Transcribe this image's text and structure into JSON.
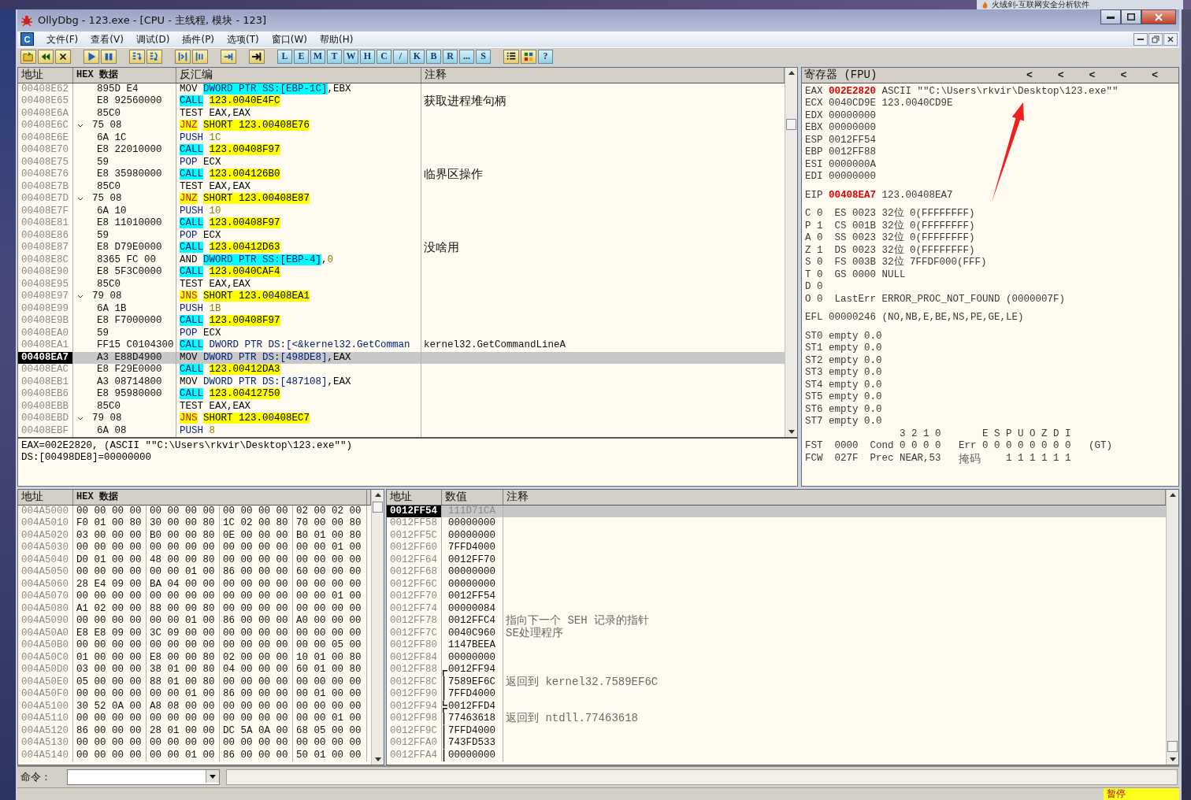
{
  "background_window": {
    "title": "火绒剑-互联网安全分析软件"
  },
  "window": {
    "title": "OllyDbg - 123.exe - [CPU - 主线程, 模块 - 123]"
  },
  "menu": {
    "icon_letter": "C",
    "items": [
      "文件(F)",
      "查看(V)",
      "调试(D)",
      "插件(P)",
      "选项(T)",
      "窗口(W)",
      "帮助(H)"
    ]
  },
  "toolbar": {
    "letter_buttons": [
      "L",
      "E",
      "M",
      "T",
      "W",
      "H",
      "C",
      "/",
      "K",
      "B",
      "R",
      "...",
      "S"
    ],
    "help_button": "?"
  },
  "disasm": {
    "headers": [
      "地址",
      "HEX 数据",
      "反汇编",
      "注释"
    ],
    "rows": [
      {
        "address": "00408E62",
        "hex": "895D E4",
        "jump": false,
        "selected": false,
        "parts": [
          {
            "kind": "plain",
            "text": "MOV"
          },
          {
            "kind": "memss",
            "text": "DWORD PTR SS:[EBP-1C]"
          },
          {
            "kind": "comma",
            "text": ",EBX"
          }
        ]
      },
      {
        "address": "00408E65",
        "hex": "E8 92560000",
        "jump": false,
        "selected": false,
        "parts": [
          {
            "kind": "call",
            "text": "CALL"
          },
          {
            "kind": "target",
            "text": "123.0040E4FC"
          }
        ],
        "comment": {
          "kind": "note",
          "text": "获取进程堆句柄"
        }
      },
      {
        "address": "00408E6A",
        "hex": "85C0",
        "jump": false,
        "selected": false,
        "parts": [
          {
            "kind": "plain",
            "text": "TEST"
          },
          {
            "kind": "plain",
            "text": "EAX,EAX"
          }
        ]
      },
      {
        "address": "00408E6C",
        "hex": "75 08",
        "jump": true,
        "selected": false,
        "parts": [
          {
            "kind": "jcc",
            "text": "JNZ"
          },
          {
            "kind": "target",
            "text": "SHORT 123.00408E76"
          }
        ]
      },
      {
        "address": "00408E6E",
        "hex": "6A 1C",
        "jump": false,
        "selected": false,
        "parts": [
          {
            "kind": "stack",
            "text": "PUSH"
          },
          {
            "kind": "const",
            "text": "1C"
          }
        ]
      },
      {
        "address": "00408E70",
        "hex": "E8 22010000",
        "jump": false,
        "selected": false,
        "parts": [
          {
            "kind": "call",
            "text": "CALL"
          },
          {
            "kind": "target",
            "text": "123.00408F97"
          }
        ]
      },
      {
        "address": "00408E75",
        "hex": "59",
        "jump": false,
        "selected": false,
        "parts": [
          {
            "kind": "stack",
            "text": "POP"
          },
          {
            "kind": "plain",
            "text": "ECX"
          }
        ]
      },
      {
        "address": "00408E76",
        "hex": "E8 35980000",
        "jump": false,
        "selected": false,
        "parts": [
          {
            "kind": "call",
            "text": "CALL"
          },
          {
            "kind": "target",
            "text": "123.004126B0"
          }
        ],
        "comment": {
          "kind": "note",
          "text": "临界区操作"
        }
      },
      {
        "address": "00408E7B",
        "hex": "85C0",
        "jump": false,
        "selected": false,
        "parts": [
          {
            "kind": "plain",
            "text": "TEST"
          },
          {
            "kind": "plain",
            "text": "EAX,EAX"
          }
        ]
      },
      {
        "address": "00408E7D",
        "hex": "75 08",
        "jump": true,
        "selected": false,
        "parts": [
          {
            "kind": "jcc",
            "text": "JNZ"
          },
          {
            "kind": "target",
            "text": "SHORT 123.00408E87"
          }
        ]
      },
      {
        "address": "00408E7F",
        "hex": "6A 10",
        "jump": false,
        "selected": false,
        "parts": [
          {
            "kind": "stack",
            "text": "PUSH"
          },
          {
            "kind": "const",
            "text": "10"
          }
        ]
      },
      {
        "address": "00408E81",
        "hex": "E8 11010000",
        "jump": false,
        "selected": false,
        "parts": [
          {
            "kind": "call",
            "text": "CALL"
          },
          {
            "kind": "target",
            "text": "123.00408F97"
          }
        ]
      },
      {
        "address": "00408E86",
        "hex": "59",
        "jump": false,
        "selected": false,
        "parts": [
          {
            "kind": "stack",
            "text": "POP"
          },
          {
            "kind": "plain",
            "text": "ECX"
          }
        ]
      },
      {
        "address": "00408E87",
        "hex": "E8 D79E0000",
        "jump": false,
        "selected": false,
        "parts": [
          {
            "kind": "call",
            "text": "CALL"
          },
          {
            "kind": "target",
            "text": "123.00412D63"
          }
        ],
        "comment": {
          "kind": "note",
          "text": "没啥用"
        }
      },
      {
        "address": "00408E8C",
        "hex": "8365 FC 00",
        "jump": false,
        "selected": false,
        "parts": [
          {
            "kind": "plain",
            "text": "AND"
          },
          {
            "kind": "memss",
            "text": "DWORD PTR SS:[EBP-4]"
          },
          {
            "kind": "comma",
            "text": ","
          },
          {
            "kind": "const",
            "text": "0"
          }
        ]
      },
      {
        "address": "00408E90",
        "hex": "E8 5F3C0000",
        "jump": false,
        "selected": false,
        "parts": [
          {
            "kind": "call",
            "text": "CALL"
          },
          {
            "kind": "target",
            "text": "123.0040CAF4"
          }
        ]
      },
      {
        "address": "00408E95",
        "hex": "85C0",
        "jump": false,
        "selected": false,
        "parts": [
          {
            "kind": "plain",
            "text": "TEST"
          },
          {
            "kind": "plain",
            "text": "EAX,EAX"
          }
        ]
      },
      {
        "address": "00408E97",
        "hex": "79 08",
        "jump": true,
        "selected": false,
        "parts": [
          {
            "kind": "jcc",
            "text": "JNS"
          },
          {
            "kind": "target",
            "text": "SHORT 123.00408EA1"
          }
        ]
      },
      {
        "address": "00408E99",
        "hex": "6A 1B",
        "jump": false,
        "selected": false,
        "parts": [
          {
            "kind": "stack",
            "text": "PUSH"
          },
          {
            "kind": "const",
            "text": "1B"
          }
        ]
      },
      {
        "address": "00408E9B",
        "hex": "E8 F7000000",
        "jump": false,
        "selected": false,
        "parts": [
          {
            "kind": "call",
            "text": "CALL"
          },
          {
            "kind": "target",
            "text": "123.00408F97"
          }
        ]
      },
      {
        "address": "00408EA0",
        "hex": "59",
        "jump": false,
        "selected": false,
        "parts": [
          {
            "kind": "stack",
            "text": "POP"
          },
          {
            "kind": "plain",
            "text": "ECX"
          }
        ]
      },
      {
        "address": "00408EA1",
        "hex": "FF15 C0104300",
        "jump": false,
        "selected": false,
        "parts": [
          {
            "kind": "call",
            "text": "CALL"
          },
          {
            "kind": "mem",
            "text": "DWORD PTR DS:[<&kernel32.GetComman"
          }
        ],
        "comment": {
          "kind": "symbol",
          "text": "kernel32.GetCommandLineA"
        }
      },
      {
        "address": "00408EA7",
        "hex": "A3 E88D4900",
        "jump": false,
        "selected": true,
        "parts": [
          {
            "kind": "plain",
            "text": "MOV"
          },
          {
            "kind": "mem",
            "text": "DWORD PTR DS:[498DE8]"
          },
          {
            "kind": "comma",
            "text": ",EAX"
          }
        ]
      },
      {
        "address": "00408EAC",
        "hex": "E8 F29E0000",
        "jump": false,
        "selected": false,
        "parts": [
          {
            "kind": "call",
            "text": "CALL"
          },
          {
            "kind": "target",
            "text": "123.00412DA3"
          }
        ]
      },
      {
        "address": "00408EB1",
        "hex": "A3 08714800",
        "jump": false,
        "selected": false,
        "parts": [
          {
            "kind": "plain",
            "text": "MOV"
          },
          {
            "kind": "mem",
            "text": "DWORD PTR DS:[487108]"
          },
          {
            "kind": "comma",
            "text": ",EAX"
          }
        ]
      },
      {
        "address": "00408EB6",
        "hex": "E8 95980000",
        "jump": false,
        "selected": false,
        "parts": [
          {
            "kind": "call",
            "text": "CALL"
          },
          {
            "kind": "target",
            "text": "123.00412750"
          }
        ]
      },
      {
        "address": "00408EBB",
        "hex": "85C0",
        "jump": false,
        "selected": false,
        "parts": [
          {
            "kind": "plain",
            "text": "TEST"
          },
          {
            "kind": "plain",
            "text": "EAX,EAX"
          }
        ]
      },
      {
        "address": "00408EBD",
        "hex": "79 08",
        "jump": true,
        "selected": false,
        "parts": [
          {
            "kind": "jcc",
            "text": "JNS"
          },
          {
            "kind": "target",
            "text": "SHORT 123.00408EC7"
          }
        ]
      },
      {
        "address": "00408EBF",
        "hex": "6A 08",
        "jump": false,
        "selected": false,
        "parts": [
          {
            "kind": "stack",
            "text": "PUSH"
          },
          {
            "kind": "const",
            "text": "8"
          }
        ]
      }
    ]
  },
  "info": {
    "lines": [
      "EAX=002E2820, (ASCII \"\"C:\\Users\\rkvir\\Desktop\\123.exe\"\")",
      "DS:[00498DE8]=00000000"
    ]
  },
  "registers": {
    "title": "寄存器 (FPU)",
    "arrows": [
      "<",
      "<",
      "<",
      "<",
      "<"
    ],
    "gprs": [
      {
        "name": "EAX",
        "value": "002E2820",
        "changed": true,
        "comment": "ASCII \"\"C:\\Users\\rkvir\\Desktop\\123.exe\"\""
      },
      {
        "name": "ECX",
        "value": "0040CD9E",
        "changed": false,
        "comment": "123.0040CD9E"
      },
      {
        "name": "EDX",
        "value": "00000000",
        "changed": false
      },
      {
        "name": "EBX",
        "value": "00000000",
        "changed": false
      },
      {
        "name": "ESP",
        "value": "0012FF54",
        "changed": false
      },
      {
        "name": "EBP",
        "value": "0012FF88",
        "changed": false
      },
      {
        "name": "ESI",
        "value": "0000000A",
        "changed": false
      },
      {
        "name": "EDI",
        "value": "00000000",
        "changed": false
      }
    ],
    "eip": {
      "name": "EIP",
      "value": "00408EA7",
      "changed": true,
      "comment": "123.00408EA7"
    },
    "flags": [
      {
        "flag": "C",
        "bit": "0",
        "info": "ES 0023 32位 0(FFFFFFFF)"
      },
      {
        "flag": "P",
        "bit": "1",
        "info": "CS 001B 32位 0(FFFFFFFF)"
      },
      {
        "flag": "A",
        "bit": "0",
        "info": "SS 0023 32位 0(FFFFFFFF)"
      },
      {
        "flag": "Z",
        "bit": "1",
        "info": "DS 0023 32位 0(FFFFFFFF)"
      },
      {
        "flag": "S",
        "bit": "0",
        "info": "FS 003B 32位 7FFDF000(FFF)"
      },
      {
        "flag": "T",
        "bit": "0",
        "info": "GS 0000 NULL"
      },
      {
        "flag": "D",
        "bit": "0"
      },
      {
        "flag": "O",
        "bit": "0",
        "info": "LastErr ERROR_PROC_NOT_FOUND (0000007F)"
      }
    ],
    "efl": {
      "name": "EFL",
      "value": "00000246",
      "comment": "(NO,NB,E,BE,NS,PE,GE,LE)"
    },
    "fpu": [
      {
        "name": "ST0",
        "tag": "empty",
        "value": "0.0"
      },
      {
        "name": "ST1",
        "tag": "empty",
        "value": "0.0"
      },
      {
        "name": "ST2",
        "tag": "empty",
        "value": "0.0"
      },
      {
        "name": "ST3",
        "tag": "empty",
        "value": "0.0"
      },
      {
        "name": "ST4",
        "tag": "empty",
        "value": "0.0"
      },
      {
        "name": "ST5",
        "tag": "empty",
        "value": "0.0"
      },
      {
        "name": "ST6",
        "tag": "empty",
        "value": "0.0"
      },
      {
        "name": "ST7",
        "tag": "empty",
        "value": "0.0"
      }
    ],
    "fpu_status": {
      "cond_header": "3 2 1 0",
      "err_header": "E S P U O Z D I",
      "fst": {
        "name": "FST",
        "value": "0000",
        "cond_label": "Cond",
        "cond": "0 0 0 0",
        "err_label": "Err",
        "err": "0 0 0 0 0 0 0 0",
        "note": "(GT)"
      },
      "fcw": {
        "name": "FCW",
        "value": "027F",
        "prec_label": "Prec",
        "prec": "NEAR,53",
        "mask_label": "掩码",
        "mask": "1 1 1 1 1 1"
      }
    }
  },
  "dump": {
    "headers": [
      "地址",
      "HEX 数据"
    ],
    "rows": [
      {
        "address": "004A5000",
        "groups": [
          "00 00 00 00",
          "00 00 00 00",
          "00 00 00 00",
          "02 00 02 00"
        ]
      },
      {
        "address": "004A5010",
        "groups": [
          "F0 01 00 80",
          "30 00 00 80",
          "1C 02 00 80",
          "70 00 00 80"
        ]
      },
      {
        "address": "004A5020",
        "groups": [
          "03 00 00 00",
          "B0 00 00 80",
          "0E 00 00 00",
          "B0 01 00 80"
        ]
      },
      {
        "address": "004A5030",
        "groups": [
          "00 00 00 00",
          "00 00 00 00",
          "00 00 00 00",
          "00 00 01 00"
        ]
      },
      {
        "address": "004A5040",
        "groups": [
          "D0 01 00 00",
          "48 00 00 80",
          "00 00 00 00",
          "00 00 00 00"
        ]
      },
      {
        "address": "004A5050",
        "groups": [
          "00 00 00 00",
          "00 00 01 00",
          "86 00 00 00",
          "60 00 00 00"
        ]
      },
      {
        "address": "004A5060",
        "groups": [
          "28 E4 09 00",
          "BA 04 00 00",
          "00 00 00 00",
          "00 00 00 00"
        ]
      },
      {
        "address": "004A5070",
        "groups": [
          "00 00 00 00",
          "00 00 00 00",
          "00 00 00 00",
          "00 00 01 00"
        ]
      },
      {
        "address": "004A5080",
        "groups": [
          "A1 02 00 00",
          "88 00 00 80",
          "00 00 00 00",
          "00 00 00 00"
        ]
      },
      {
        "address": "004A5090",
        "groups": [
          "00 00 00 00",
          "00 00 01 00",
          "86 00 00 00",
          "A0 00 00 00"
        ]
      },
      {
        "address": "004A50A0",
        "groups": [
          "E8 E8 09 00",
          "3C 09 00 00",
          "00 00 00 00",
          "00 00 00 00"
        ]
      },
      {
        "address": "004A50B0",
        "groups": [
          "00 00 00 00",
          "00 00 00 00",
          "00 00 00 00",
          "00 00 05 00"
        ]
      },
      {
        "address": "004A50C0",
        "groups": [
          "01 00 00 00",
          "E8 00 00 80",
          "02 00 00 00",
          "10 01 00 80"
        ]
      },
      {
        "address": "004A50D0",
        "groups": [
          "03 00 00 00",
          "38 01 00 80",
          "04 00 00 00",
          "60 01 00 80"
        ]
      },
      {
        "address": "004A50E0",
        "groups": [
          "05 00 00 00",
          "88 01 00 80",
          "00 00 00 00",
          "00 00 00 00"
        ]
      },
      {
        "address": "004A50F0",
        "groups": [
          "00 00 00 00",
          "00 00 01 00",
          "86 00 00 00",
          "00 01 00 00"
        ]
      },
      {
        "address": "004A5100",
        "groups": [
          "30 52 0A 00",
          "A8 08 00 00",
          "00 00 00 00",
          "00 00 00 00"
        ]
      },
      {
        "address": "004A5110",
        "groups": [
          "00 00 00 00",
          "00 00 00 00",
          "00 00 00 00",
          "00 00 01 00"
        ]
      },
      {
        "address": "004A5120",
        "groups": [
          "86 00 00 00",
          "28 01 00 00",
          "DC 5A 0A 00",
          "68 05 00 00"
        ]
      },
      {
        "address": "004A5130",
        "groups": [
          "00 00 00 00",
          "00 00 00 00",
          "00 00 00 00",
          "00 00 00 00"
        ]
      },
      {
        "address": "004A5140",
        "groups": [
          "00 00 00 00",
          "00 00 01 00",
          "86 00 00 00",
          "50 01 00 00"
        ]
      }
    ]
  },
  "stack": {
    "headers": [
      "地址",
      "数值",
      "注释"
    ],
    "rows": [
      {
        "kind": "plain",
        "address": "0012FF54",
        "value": "111D71CA",
        "selected": true
      },
      {
        "kind": "plain",
        "address": "0012FF58",
        "value": "00000000",
        "selected": false
      },
      {
        "kind": "plain",
        "address": "0012FF5C",
        "value": "00000000",
        "selected": false
      },
      {
        "kind": "plain",
        "address": "0012FF60",
        "value": "7FFD4000",
        "selected": false
      },
      {
        "kind": "plain",
        "address": "0012FF64",
        "value": "0012FF70",
        "selected": false
      },
      {
        "kind": "plain",
        "address": "0012FF68",
        "value": "00000000",
        "selected": false
      },
      {
        "kind": "plain",
        "address": "0012FF6C",
        "value": "00000000",
        "selected": false
      },
      {
        "kind": "plain",
        "address": "0012FF70",
        "value": "0012FF54",
        "selected": false
      },
      {
        "kind": "plain",
        "address": "0012FF74",
        "value": "00000084",
        "selected": false
      },
      {
        "kind": "plain",
        "address": "0012FF78",
        "value": "0012FFC4",
        "selected": false,
        "comment": "指向下一个 SEH 记录的指针"
      },
      {
        "kind": "plain",
        "address": "0012FF7C",
        "value": "0040C960",
        "selected": false,
        "comment": "SE处理程序"
      },
      {
        "kind": "plain",
        "address": "0012FF80",
        "value": "1147BEEA",
        "selected": false
      },
      {
        "kind": "plain",
        "address": "0012FF84",
        "value": "00000000",
        "selected": false
      },
      {
        "kind": "frametop",
        "address": "0012FF88",
        "value": "0012FF94",
        "selected": false
      },
      {
        "kind": "framemid",
        "address": "0012FF8C",
        "value": "7589EF6C",
        "selected": false,
        "comment": "返回到 kernel32.7589EF6C"
      },
      {
        "kind": "framemid",
        "address": "0012FF90",
        "value": "7FFD4000",
        "selected": false
      },
      {
        "kind": "framesplit",
        "address": "0012FF94",
        "value": "0012FFD4",
        "selected": false
      },
      {
        "kind": "framemid",
        "address": "0012FF98",
        "value": "77463618",
        "selected": false,
        "comment": "返回到 ntdll.77463618"
      },
      {
        "kind": "framemid",
        "address": "0012FF9C",
        "value": "7FFD4000",
        "selected": false
      },
      {
        "kind": "framemid",
        "address": "0012FFA0",
        "value": "743FD533",
        "selected": false
      },
      {
        "kind": "framemid",
        "address": "0012FFA4",
        "value": "00000000",
        "selected": false
      }
    ]
  },
  "command": {
    "label": "命令 :"
  },
  "status": {
    "state": "暂停"
  }
}
